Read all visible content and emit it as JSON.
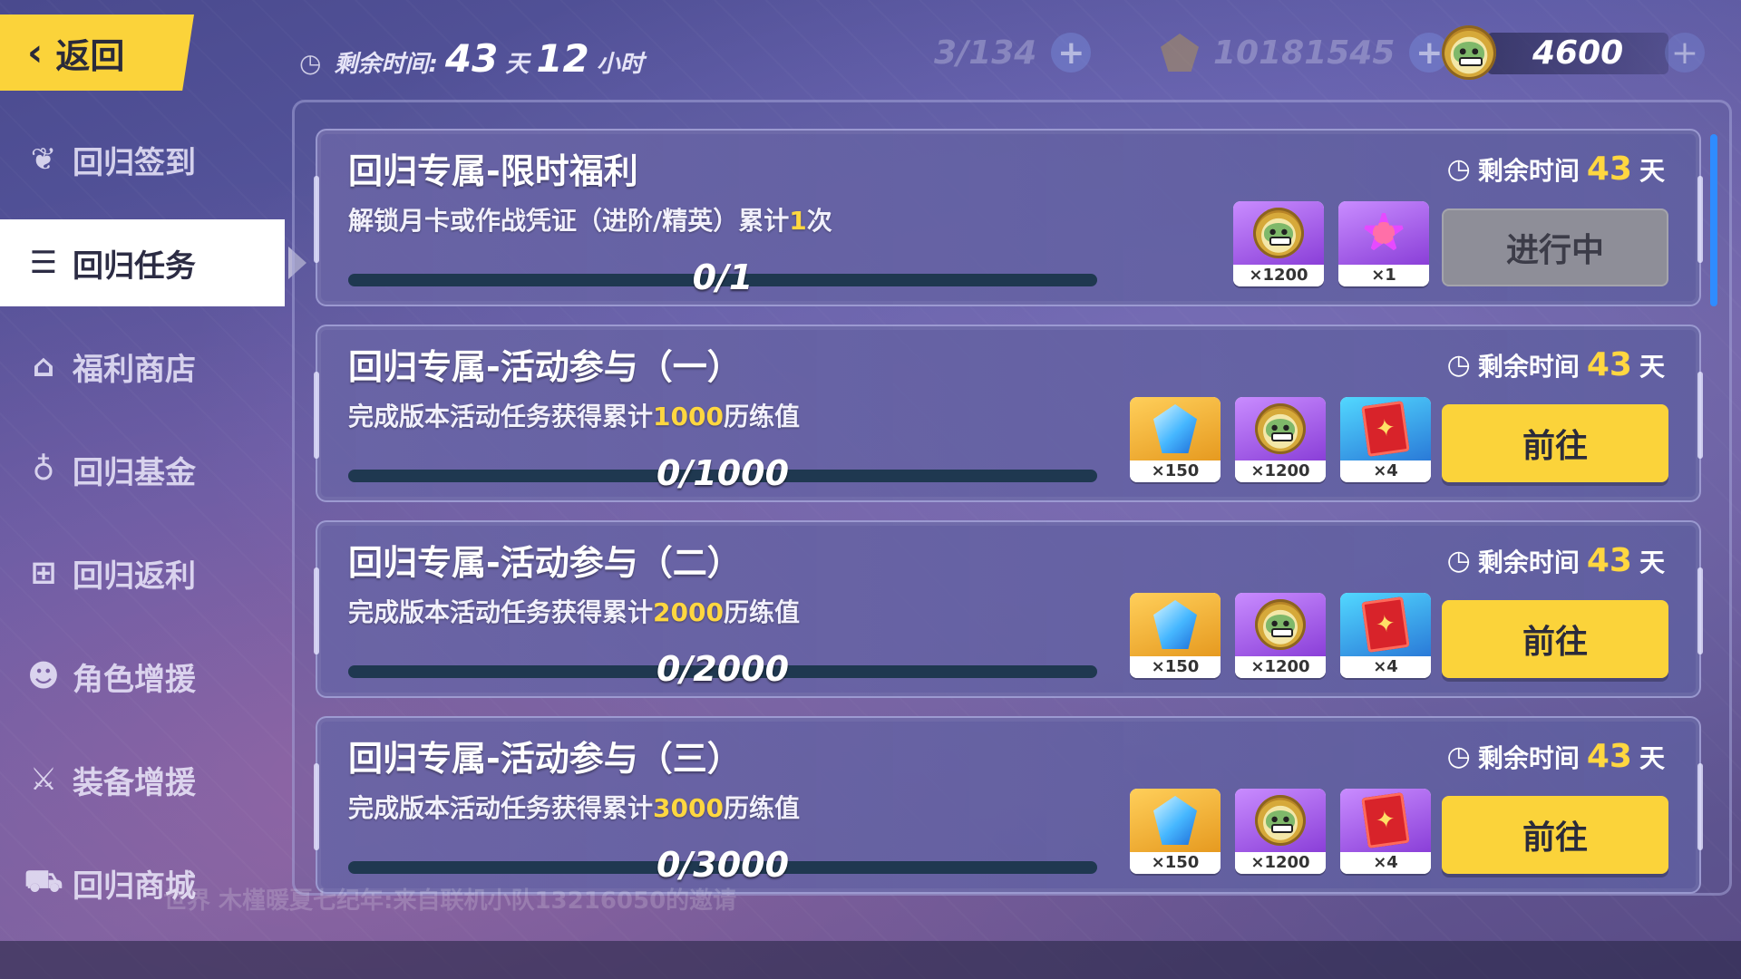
{
  "header": {
    "back_label": "返回",
    "timer_label": "剩余时间:",
    "timer_days": "43",
    "timer_days_unit": "天",
    "timer_hours": "12",
    "timer_hours_unit": "小时",
    "stamina": "3/134",
    "crystals": "10181545",
    "coins": "4600"
  },
  "sidebar": {
    "items": [
      {
        "label": "回归签到",
        "icon": "wings-icon"
      },
      {
        "label": "回归任务",
        "icon": "list-icon"
      },
      {
        "label": "福利商店",
        "icon": "shop-icon"
      },
      {
        "label": "回归基金",
        "icon": "fund-icon"
      },
      {
        "label": "回归返利",
        "icon": "gift-icon"
      },
      {
        "label": "角色增援",
        "icon": "character-icon"
      },
      {
        "label": "装备增援",
        "icon": "weapon-icon"
      },
      {
        "label": "回归商城",
        "icon": "cart-icon"
      }
    ],
    "active_index": 1
  },
  "tasks": [
    {
      "title": "回归专属-限时福利",
      "desc_pre": "解锁月卡或作战凭证（进阶/精英）累计",
      "desc_hl": "1",
      "desc_post": "次",
      "progress_text": "0/1",
      "progress_fraction": 0,
      "time_label": "剩余时间",
      "time_days": "43",
      "time_unit": "天",
      "action": "进行中",
      "rewards": [
        {
          "icon": "coin-icon",
          "rarity": "purple",
          "qty": "×1200"
        },
        {
          "icon": "burst-icon",
          "rarity": "purple",
          "qty": "×1"
        }
      ]
    },
    {
      "title": "回归专属-活动参与（一）",
      "desc_pre": "完成版本活动任务获得累计",
      "desc_hl": "1000",
      "desc_post": "历练值",
      "progress_text": "0/1000",
      "progress_fraction": 0,
      "time_label": "剩余时间",
      "time_days": "43",
      "time_unit": "天",
      "action": "前往",
      "rewards": [
        {
          "icon": "crystal-icon",
          "rarity": "gold",
          "qty": "×150"
        },
        {
          "icon": "coin-icon",
          "rarity": "purple",
          "qty": "×1200"
        },
        {
          "icon": "ticket-icon",
          "rarity": "blue",
          "qty": "×4"
        }
      ]
    },
    {
      "title": "回归专属-活动参与（二）",
      "desc_pre": "完成版本活动任务获得累计",
      "desc_hl": "2000",
      "desc_post": "历练值",
      "progress_text": "0/2000",
      "progress_fraction": 0,
      "time_label": "剩余时间",
      "time_days": "43",
      "time_unit": "天",
      "action": "前往",
      "rewards": [
        {
          "icon": "crystal-icon",
          "rarity": "gold",
          "qty": "×150"
        },
        {
          "icon": "coin-icon",
          "rarity": "purple",
          "qty": "×1200"
        },
        {
          "icon": "ticket-icon",
          "rarity": "blue",
          "qty": "×4"
        }
      ]
    },
    {
      "title": "回归专属-活动参与（三）",
      "desc_pre": "完成版本活动任务获得累计",
      "desc_hl": "3000",
      "desc_post": "历练值",
      "progress_text": "0/3000",
      "progress_fraction": 0,
      "time_label": "剩余时间",
      "time_days": "43",
      "time_unit": "天",
      "action": "前往",
      "rewards": [
        {
          "icon": "crystal-icon",
          "rarity": "gold",
          "qty": "×150"
        },
        {
          "icon": "coin-icon",
          "rarity": "purple",
          "qty": "×1200"
        },
        {
          "icon": "ticket-icon",
          "rarity": "purple",
          "qty": "×4"
        }
      ]
    }
  ],
  "footer": {
    "chat_text": "世界 木槿暖夏七纪年:来自联机小队13216050的邀请"
  },
  "colors": {
    "accent_yellow": "#fbd33a",
    "highlight_text": "#ffd740",
    "busy_button": "#8e8e98"
  }
}
